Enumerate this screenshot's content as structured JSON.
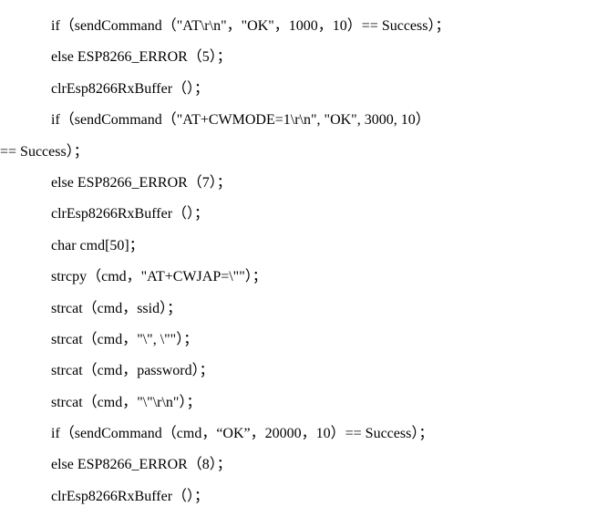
{
  "lines": [
    {
      "text": "if（sendCommand（\"AT\\r\\n\"，\"OK\"，1000，10）== Success）；",
      "outdent": false
    },
    {
      "text": "else ESP8266_ERROR（5）；",
      "outdent": false
    },
    {
      "text": "clrEsp8266RxBuffer（）；",
      "outdent": false
    },
    {
      "text": "if（sendCommand（\"AT+CWMODE=1\\r\\n\", \"OK\", 3000, 10）",
      "outdent": false
    },
    {
      "text": "== Success）；",
      "outdent": true
    },
    {
      "text": "else ESP8266_ERROR（7）；",
      "outdent": false
    },
    {
      "text": "clrEsp8266RxBuffer（）；",
      "outdent": false
    },
    {
      "text": "char cmd[50]；",
      "outdent": false
    },
    {
      "text": "strcpy（cmd，\"AT+CWJAP=\\\"\"）；",
      "outdent": false
    },
    {
      "text": "strcat（cmd，ssid）；",
      "outdent": false
    },
    {
      "text": "strcat（cmd，\"\\\", \\\"\"）；",
      "outdent": false
    },
    {
      "text": "strcat（cmd，password）；",
      "outdent": false
    },
    {
      "text": "strcat（cmd，\"\\\"\\r\\n\"）；",
      "outdent": false
    },
    {
      "text": "if（sendCommand（cmd，“OK”，20000，10）== Success）；",
      "outdent": false
    },
    {
      "text": "else ESP8266_ERROR（8）；",
      "outdent": false
    },
    {
      "text": "clrEsp8266RxBuffer（）；",
      "outdent": false
    }
  ]
}
